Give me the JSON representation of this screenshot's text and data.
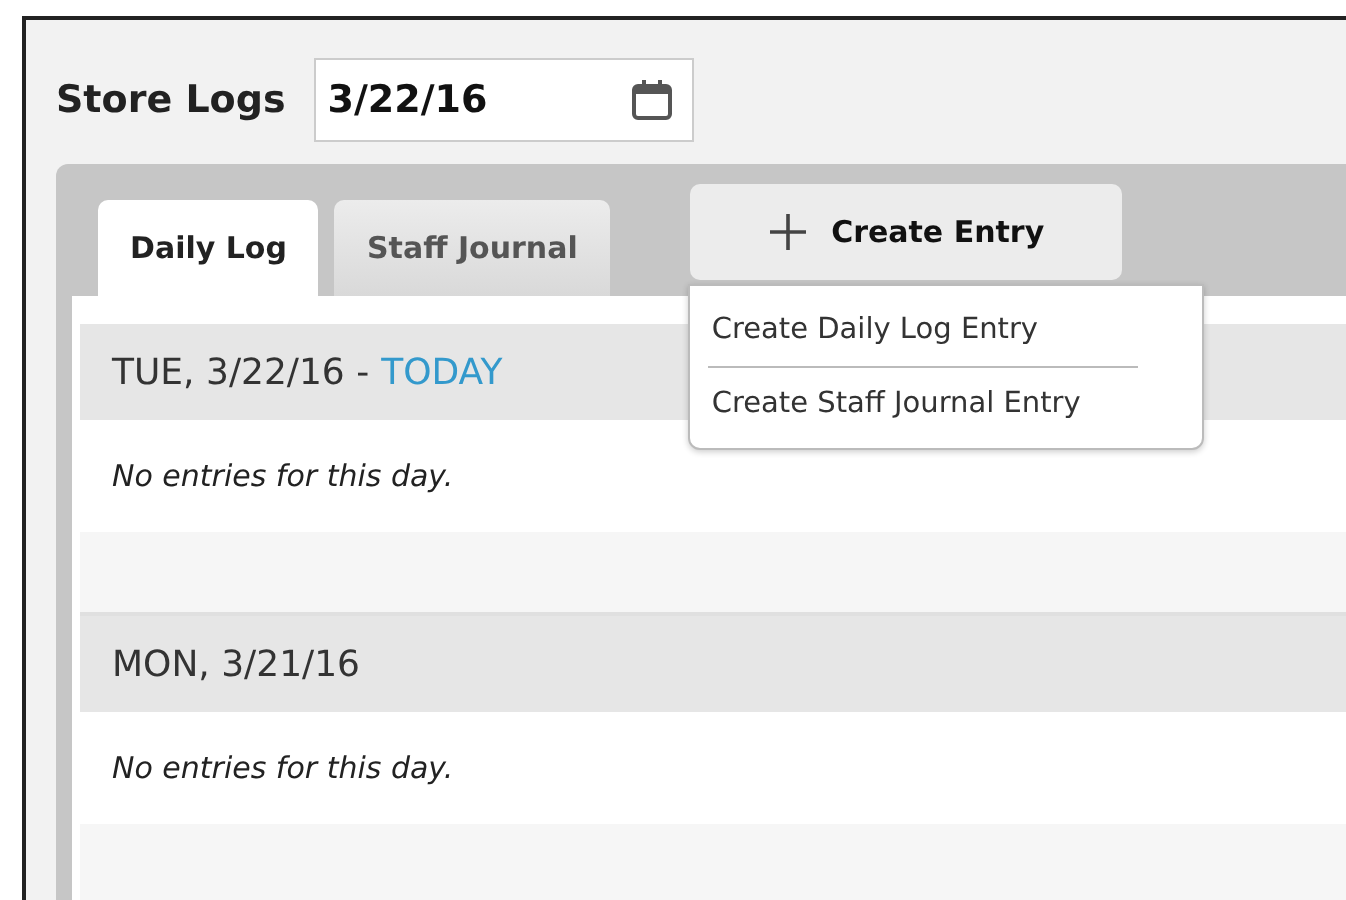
{
  "title": "Store Logs",
  "date_field": {
    "value": "3/22/16"
  },
  "tabs": [
    {
      "label": "Daily Log",
      "selected": true
    },
    {
      "label": "Staff Journal",
      "selected": false
    }
  ],
  "create_button": {
    "label": "Create Entry",
    "expanded": true
  },
  "create_menu": [
    "Create Daily Log Entry",
    "Create Staff Journal Entry"
  ],
  "days": [
    {
      "heading": "TUE, 3/22/16 -",
      "today_badge": "TODAY",
      "message": "No entries for this day."
    },
    {
      "heading": "MON, 3/21/16",
      "message": "No entries for this day."
    }
  ]
}
